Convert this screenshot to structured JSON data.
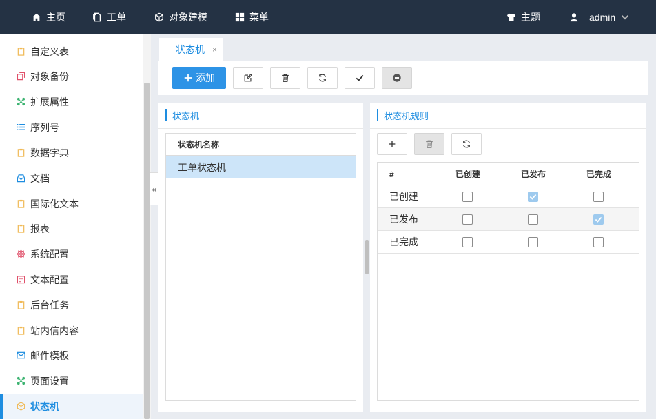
{
  "topnav": {
    "home": "主页",
    "workorder": "工单",
    "modeling": "对象建模",
    "menu": "菜单",
    "theme": "主题",
    "user": "admin"
  },
  "sidebar": {
    "items": [
      {
        "label": "自定义表",
        "icon": "clipboard-icon",
        "color": "#f0b955"
      },
      {
        "label": "对象备份",
        "icon": "copy-icon",
        "color": "#e0506a"
      },
      {
        "label": "扩展属性",
        "icon": "network-icon",
        "color": "#3cb371"
      },
      {
        "label": "序列号",
        "icon": "list-icon",
        "color": "#1e8de0"
      },
      {
        "label": "数据字典",
        "icon": "clipboard-icon",
        "color": "#f0b955"
      },
      {
        "label": "文档",
        "icon": "inbox-icon",
        "color": "#1e8de0"
      },
      {
        "label": "国际化文本",
        "icon": "clipboard-icon",
        "color": "#f0b955"
      },
      {
        "label": "报表",
        "icon": "clipboard-icon",
        "color": "#f0b955"
      },
      {
        "label": "系统配置",
        "icon": "gear-icon",
        "color": "#e0506a"
      },
      {
        "label": "文本配置",
        "icon": "calendar-icon",
        "color": "#e0506a"
      },
      {
        "label": "后台任务",
        "icon": "clipboard-icon",
        "color": "#f0b955"
      },
      {
        "label": "站内信内容",
        "icon": "clipboard-icon",
        "color": "#f0b955"
      },
      {
        "label": "邮件模板",
        "icon": "mail-icon",
        "color": "#1e8de0"
      },
      {
        "label": "页面设置",
        "icon": "network-icon",
        "color": "#3cb371"
      },
      {
        "label": "状态机",
        "icon": "cube-icon",
        "color": "#f0b955",
        "active": true
      }
    ],
    "collapse_glyph": "«"
  },
  "tab": {
    "label": "状态机",
    "close": "×"
  },
  "toolbar": {
    "add_label": "添加"
  },
  "left_panel": {
    "title": "状态机",
    "column_header": "状态机名称",
    "rows": [
      "工单状态机"
    ]
  },
  "right_panel": {
    "title": "状态机规则",
    "columns": [
      "#",
      "已创建",
      "已发布",
      "已完成"
    ],
    "rows": [
      {
        "name": "已创建",
        "checks": [
          false,
          true,
          false
        ]
      },
      {
        "name": "已发布",
        "checks": [
          false,
          false,
          true
        ]
      },
      {
        "name": "已完成",
        "checks": [
          false,
          false,
          false
        ]
      }
    ]
  },
  "colors": {
    "accent": "#1e8de0",
    "topbar": "#243244",
    "selected_row": "#cde5f9"
  }
}
